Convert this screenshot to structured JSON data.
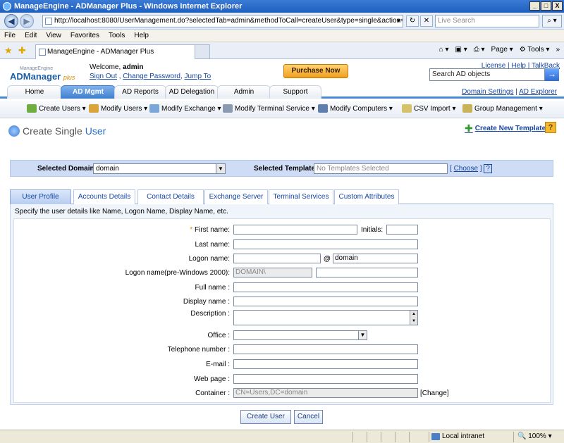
{
  "window": {
    "title": "ManageEngine - ADManager Plus - Windows Internet Explorer",
    "buttons": [
      "_",
      "□",
      "X"
    ]
  },
  "browser": {
    "url": "http://localhost:8080/UserManagement.do?selectedTab=admin&methodToCall=createUser&type=single&action=new",
    "search_placeholder": "Live Search",
    "menu": [
      "File",
      "Edit",
      "View",
      "Favorites",
      "Tools",
      "Help"
    ],
    "tab_title": "ManageEngine - ADManager Plus",
    "commands": [
      "Page",
      "Tools"
    ],
    "status_zone": "Local intranet",
    "zoom": "100%"
  },
  "header": {
    "logo_small": "ManageEngine",
    "logo_main": "ADManager",
    "logo_plus": "plus",
    "welcome_prefix": "Welcome,",
    "username": "admin",
    "sign_out": "Sign Out",
    "change_password": "Change Password",
    "jump_to": "Jump To",
    "purchase_label": "Purchase Now",
    "license": "License",
    "help": "Help",
    "talkback": "TalkBack",
    "ad_search_placeholder": "Search AD objects"
  },
  "main_tabs": [
    "Home",
    "AD Mgmt",
    "AD Reports",
    "AD Delegation",
    "Admin",
    "Support"
  ],
  "domain_links": {
    "settings": "Domain Settings",
    "explorer": "AD Explorer"
  },
  "submenu": [
    "Create Users",
    "Modify Users",
    "Modify Exchange",
    "Modify Terminal Service",
    "Modify Computers",
    "CSV Import",
    "Group Management"
  ],
  "page": {
    "title_prefix": "Create Single",
    "title_highlight": "User",
    "new_template": "Create New Template",
    "help_mark": "?"
  },
  "domain_bar": {
    "domain_label": "Selected Domain:",
    "domain_value": "domain",
    "template_label": "Selected Template:",
    "template_value": "No Templates Selected",
    "choose": "Choose"
  },
  "form_tabs": [
    "User Profile",
    "Accounts Details",
    "Contact Details",
    "Exchange Server",
    "Terminal Services",
    "Custom Attributes"
  ],
  "form": {
    "hint": "Specify the user details like Name, Logon Name, Display Name, etc.",
    "required_mark": "*",
    "first_name_label": "First name:",
    "initials_label": "Initials:",
    "last_name_label": "Last name:",
    "logon_name_label": "Logon name:",
    "at_sign": "@",
    "logon_domain": "domain",
    "pre2000_label": "Logon name(pre-Windows 2000):",
    "pre2000_domain": "DOMAIN\\",
    "full_name_label": "Full name :",
    "display_name_label": "Display name :",
    "description_label": "Description :",
    "office_label": "Office :",
    "telephone_label": "Telephone number :",
    "email_label": "E-mail :",
    "web_page_label": "Web page :",
    "container_label": "Container :",
    "container_value": "CN=Users,DC=domain",
    "change_link": "[Change]"
  },
  "buttons": {
    "create": "Create User",
    "cancel": "Cancel"
  }
}
